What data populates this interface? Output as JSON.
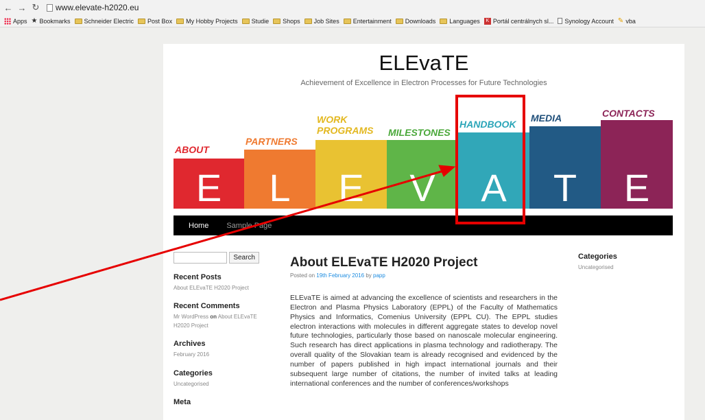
{
  "browser": {
    "url": "www.elevate-h2020.eu",
    "bookmarks": [
      {
        "label": "Apps",
        "icon": "apps-grid-icon"
      },
      {
        "label": "Bookmarks",
        "icon": "star-icon"
      },
      {
        "label": "Schneider Electric",
        "icon": "folder-icon"
      },
      {
        "label": "Post Box",
        "icon": "folder-icon"
      },
      {
        "label": "My Hobby Projects",
        "icon": "folder-icon"
      },
      {
        "label": "Studie",
        "icon": "folder-icon"
      },
      {
        "label": "Shops",
        "icon": "folder-icon"
      },
      {
        "label": "Job Sites",
        "icon": "folder-icon"
      },
      {
        "label": "Entertainment",
        "icon": "folder-icon"
      },
      {
        "label": "Downloads",
        "icon": "folder-icon"
      },
      {
        "label": "Languages",
        "icon": "folder-icon"
      },
      {
        "label": "Portál centrálnych sl...",
        "icon": "site-icon"
      },
      {
        "label": "Synology Account",
        "icon": "page-icon"
      },
      {
        "label": "vba",
        "icon": "site-icon"
      }
    ]
  },
  "site": {
    "title": "ELEvaTE",
    "description": "Achievement of Excellence in Electron Processes for Future Technologies"
  },
  "banner": [
    {
      "letter": "E",
      "caption": "ABOUT",
      "color": "#e0282f",
      "caption_color": "#e0282f"
    },
    {
      "letter": "L",
      "caption": "PARTNERS",
      "color": "#ef7a30",
      "caption_color": "#ef7a30"
    },
    {
      "letter": "E",
      "caption": "WORK PROGRAMS",
      "caption_line1": "WORK",
      "caption_line2": "PROGRAMS",
      "color": "#e9c232",
      "caption_color": "#e3b820"
    },
    {
      "letter": "V",
      "caption": "MILESTONES",
      "color": "#5fb548",
      "caption_color": "#4aa83a"
    },
    {
      "letter": "A",
      "caption": "HANDBOOK",
      "color": "#31a7b8",
      "caption_color": "#2aa5b8"
    },
    {
      "letter": "T",
      "caption": "MEDIA",
      "color": "#225a85",
      "caption_color": "#1f4f7a"
    },
    {
      "letter": "E",
      "caption": "CONTACTS",
      "color": "#8c2457",
      "caption_color": "#8c2457"
    }
  ],
  "menu": {
    "home": "Home",
    "sample": "Sample Page"
  },
  "sidebar_left": {
    "search_button": "Search",
    "recent_posts_title": "Recent Posts",
    "recent_post_1": "About ELEvaTE H2020 Project",
    "recent_comments_title": "Recent Comments",
    "comment_author": "Mr WordPress",
    "comment_on": "on",
    "comment_post": "About ELEvaTE H2020 Project",
    "archives_title": "Archives",
    "archive_1": "February 2016",
    "categories_title": "Categories",
    "category_1": "Uncategorised",
    "meta_title": "Meta"
  },
  "post": {
    "title": "About ELEvaTE H2020 Project",
    "meta_prefix": "Posted on",
    "date": "19th February 2016",
    "meta_by": "by",
    "author": "papp",
    "body": "ELEvaTE is aimed at advancing the excellence of scientists and researchers in the Electron and Plasma Physics Laboratory (EPPL) of the Faculty of Mathematics Physics and Informatics, Comenius University (EPPL CU). The EPPL studies electron interactions with molecules in different aggregate states to develop novel future technologies, particularly those based on nanoscale molecular engineering. Such research has direct applications in plasma technology and radiotherapy. The overall quality of the Slovakian team is already recognised and evidenced by the number of papers published in high impact international journals and their subsequent large number of citations, the number of invited talks at leading international conferences and the number of conferences/workshops"
  },
  "sidebar_right": {
    "categories_title": "Categories",
    "category_1": "Uncategorised"
  },
  "annotation": {
    "color": "#e60000",
    "highlighted_item": "HANDBOOK"
  }
}
